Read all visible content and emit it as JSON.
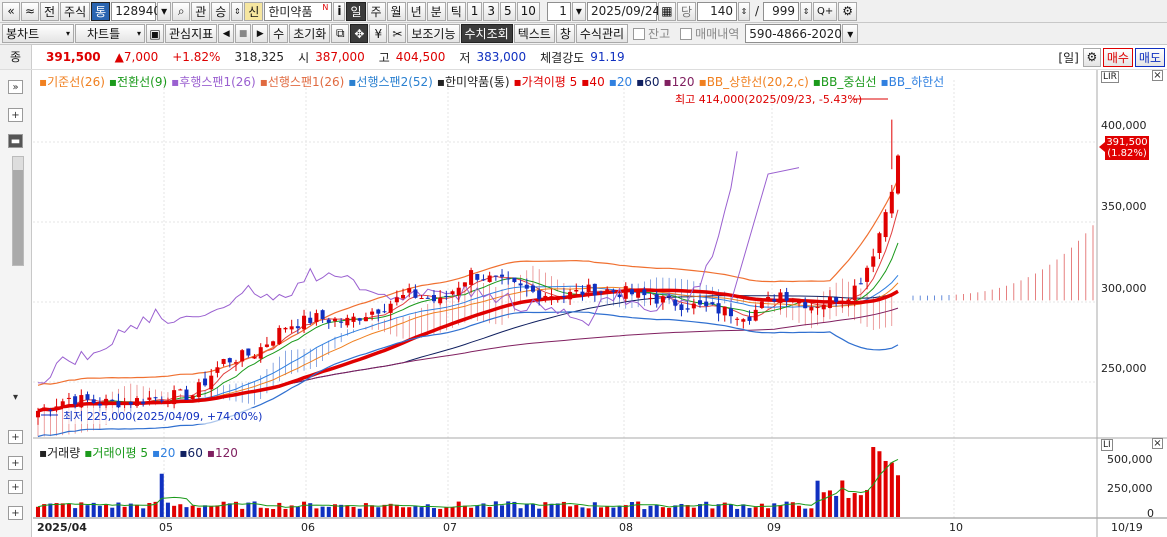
{
  "toolbar1": {
    "nav_prev": "«",
    "nav_up": "≈",
    "jeon": "전",
    "market": "주식",
    "tong": "통",
    "code": "128940",
    "zoom_icon": "⌕",
    "gwan": "관",
    "seung": "승",
    "sin": "신",
    "stock_name": "한미약품",
    "n_badge": "N",
    "i": "i",
    "il": "일",
    "ju": "주",
    "wol": "월",
    "nyeon": "년",
    "bun": "분",
    "tik": "틱",
    "p1": "1",
    "p3": "3",
    "p5": "5",
    "p10": "10",
    "period_value": "1",
    "date": "2025/09/24",
    "dang": "당",
    "count": "140",
    "slash": "/",
    "max": "999",
    "q_plus": "Q+",
    "gear": "⚙"
  },
  "toolbar2": {
    "candle": "봉차트",
    "charttype": "차트틀",
    "watch": "관심지표",
    "init": "초기화",
    "aux": "보조기능",
    "sugi": "수치조회",
    "text": "텍스트",
    "window": "창",
    "formula": "수식관리",
    "jango": "잔고",
    "trade_history": "매매내역",
    "account": "590-4866-2020-1",
    "su": "수"
  },
  "info": {
    "jong": "종",
    "price": "391,500",
    "change": "▲7,000",
    "rate": "+1.82%",
    "volume": "318,325",
    "si_label": "시",
    "open": "387,000",
    "go_label": "고",
    "high": "404,500",
    "jeo_label": "저",
    "low": "383,000",
    "strength_label": "체결강도",
    "strength": "91.19",
    "period_tag": "[일]",
    "buy": "매수",
    "sell": "매도"
  },
  "legend_top": [
    {
      "text": "기준선(26)",
      "color": "#f08020"
    },
    {
      "text": "전환선(9)",
      "color": "#1b9a1b"
    },
    {
      "text": "후행스팬1(26)",
      "color": "#9a60d0"
    },
    {
      "text": "선행스팬1(26)",
      "color": "#e06a40"
    },
    {
      "text": "선행스팬2(52)",
      "color": "#2a80d0"
    },
    {
      "text": "한미약품(통)",
      "color": "#222222"
    },
    {
      "text": "가격이평 5",
      "color": "#e00000"
    },
    {
      "text": "40",
      "color": "#e00000"
    },
    {
      "text": "20",
      "color": "#3080e0"
    },
    {
      "text": "60",
      "color": "#102060"
    },
    {
      "text": "120",
      "color": "#802060"
    },
    {
      "text": "BB_상한선(20,2,c)",
      "color": "#f08020"
    },
    {
      "text": "BB_중심선",
      "color": "#1b9a1b"
    },
    {
      "text": "BB_하한선",
      "color": "#3080e0"
    }
  ],
  "legend_vol": [
    {
      "text": "거래량",
      "color": "#222222"
    },
    {
      "text": "거래이평 5",
      "color": "#1b9a1b"
    },
    {
      "text": "20",
      "color": "#3080e0"
    },
    {
      "text": "60",
      "color": "#102060"
    },
    {
      "text": "120",
      "color": "#802060"
    }
  ],
  "annotations": {
    "high": "최고 414,000(2025/09/23, -5.43%)",
    "low": "최저 225,000(2025/04/09, +74.00%)",
    "last_price": "391,500",
    "last_rate": "(1.82%)"
  },
  "colors": {
    "up": "#e00000",
    "down": "#1030c0",
    "ichimoku_up": "#e06060",
    "ichimoku_down": "#4070d0"
  },
  "y_axis": [
    "400,000",
    "350,000",
    "300,000",
    "250,000"
  ],
  "vol_axis": [
    "500,000",
    "250,000",
    "0"
  ],
  "x_axis": [
    "2025/04",
    "05",
    "06",
    "07",
    "08",
    "09",
    "10",
    "10/19"
  ],
  "chart_data": {
    "type": "candlestick",
    "instrument": "한미약품(통) 128940",
    "period": "daily",
    "ylim": [
      220000,
      420000
    ],
    "close_path": [
      [
        0,
        232000
      ],
      [
        5,
        240000
      ],
      [
        10,
        237000
      ],
      [
        15,
        238000
      ],
      [
        20,
        241000
      ],
      [
        25,
        242000
      ],
      [
        30,
        263000
      ],
      [
        35,
        268000
      ],
      [
        40,
        285000
      ],
      [
        45,
        290000
      ],
      [
        50,
        288000
      ],
      [
        55,
        296000
      ],
      [
        60,
        305000
      ],
      [
        65,
        300000
      ],
      [
        70,
        318000
      ],
      [
        75,
        312000
      ],
      [
        80,
        306000
      ],
      [
        85,
        304000
      ],
      [
        90,
        308000
      ],
      [
        95,
        306000
      ],
      [
        100,
        302000
      ],
      [
        105,
        298000
      ],
      [
        110,
        295000
      ],
      [
        115,
        292000
      ],
      [
        120,
        306000
      ],
      [
        125,
        298000
      ],
      [
        130,
        303000
      ],
      [
        135,
        318000
      ],
      [
        139,
        391500
      ]
    ],
    "volume_max": 500000
  }
}
